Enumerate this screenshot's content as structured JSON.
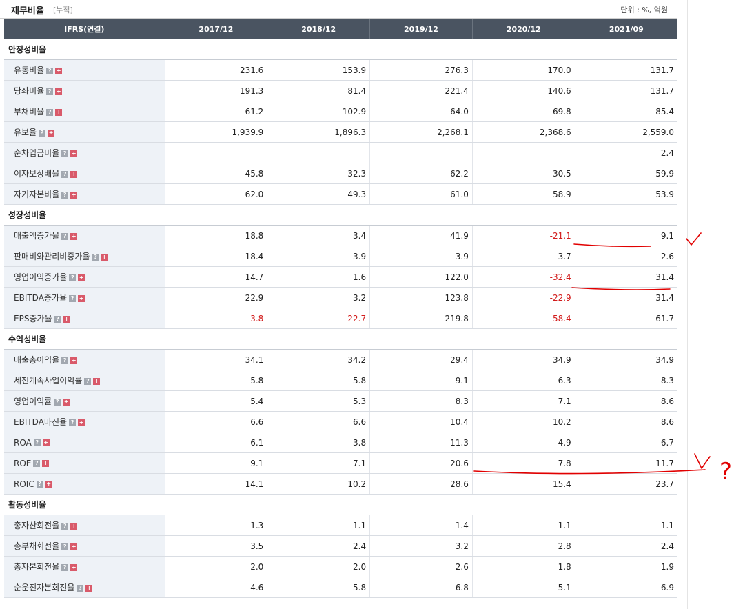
{
  "header": {
    "title": "재무비율",
    "subtitle": "[누적]",
    "unit": "단위 : %, 억원"
  },
  "columns": [
    "IFRS(연결)",
    "2017/12",
    "2018/12",
    "2019/12",
    "2020/12",
    "2021/09"
  ],
  "sections": [
    {
      "name": "안정성비율",
      "rows": [
        {
          "label": "유동비율",
          "values": [
            "231.6",
            "153.9",
            "276.3",
            "170.0",
            "131.7"
          ]
        },
        {
          "label": "당좌비율",
          "values": [
            "191.3",
            "81.4",
            "221.4",
            "140.6",
            "131.7"
          ]
        },
        {
          "label": "부채비율",
          "values": [
            "61.2",
            "102.9",
            "64.0",
            "69.8",
            "85.4"
          ]
        },
        {
          "label": "유보율",
          "values": [
            "1,939.9",
            "1,896.3",
            "2,268.1",
            "2,368.6",
            "2,559.0"
          ]
        },
        {
          "label": "순차입금비율",
          "values": [
            "",
            "",
            "",
            "",
            "2.4"
          ]
        },
        {
          "label": "이자보상배율",
          "values": [
            "45.8",
            "32.3",
            "62.2",
            "30.5",
            "59.9"
          ]
        },
        {
          "label": "자기자본비율",
          "values": [
            "62.0",
            "49.3",
            "61.0",
            "58.9",
            "53.9"
          ]
        }
      ]
    },
    {
      "name": "성장성비율",
      "rows": [
        {
          "label": "매출액증가율",
          "values": [
            "18.8",
            "3.4",
            "41.9",
            "-21.1",
            "9.1"
          ]
        },
        {
          "label": "판매비와관리비증가율",
          "values": [
            "18.4",
            "3.9",
            "3.9",
            "3.7",
            "2.6"
          ]
        },
        {
          "label": "영업이익증가율",
          "values": [
            "14.7",
            "1.6",
            "122.0",
            "-32.4",
            "31.4"
          ]
        },
        {
          "label": "EBITDA증가율",
          "values": [
            "22.9",
            "3.2",
            "123.8",
            "-22.9",
            "31.4"
          ]
        },
        {
          "label": "EPS증가율",
          "values": [
            "-3.8",
            "-22.7",
            "219.8",
            "-58.4",
            "61.7"
          ]
        }
      ]
    },
    {
      "name": "수익성비율",
      "rows": [
        {
          "label": "매출총이익율",
          "values": [
            "34.1",
            "34.2",
            "29.4",
            "34.9",
            "34.9"
          ]
        },
        {
          "label": "세전계속사업이익률",
          "values": [
            "5.8",
            "5.8",
            "9.1",
            "6.3",
            "8.3"
          ]
        },
        {
          "label": "영업이익률",
          "values": [
            "5.4",
            "5.3",
            "8.3",
            "7.1",
            "8.6"
          ]
        },
        {
          "label": "EBITDA마진율",
          "values": [
            "6.6",
            "6.6",
            "10.4",
            "10.2",
            "8.6"
          ]
        },
        {
          "label": "ROA",
          "values": [
            "6.1",
            "3.8",
            "11.3",
            "4.9",
            "6.7"
          ]
        },
        {
          "label": "ROE",
          "values": [
            "9.1",
            "7.1",
            "20.6",
            "7.8",
            "11.7"
          ]
        },
        {
          "label": "ROIC",
          "values": [
            "14.1",
            "10.2",
            "28.6",
            "15.4",
            "23.7"
          ]
        }
      ]
    },
    {
      "name": "활동성비율",
      "rows": [
        {
          "label": "총자산회전율",
          "values": [
            "1.3",
            "1.1",
            "1.4",
            "1.1",
            "1.1"
          ]
        },
        {
          "label": "총부채회전율",
          "values": [
            "3.5",
            "2.4",
            "3.2",
            "2.8",
            "2.4"
          ]
        },
        {
          "label": "총자본회전율",
          "values": [
            "2.0",
            "2.0",
            "2.6",
            "1.8",
            "1.9"
          ]
        },
        {
          "label": "순운전자본회전율",
          "values": [
            "4.6",
            "5.8",
            "6.8",
            "5.1",
            "6.9"
          ]
        }
      ]
    }
  ],
  "icons": {
    "help": "question-icon",
    "expand": "plus-icon"
  },
  "colors": {
    "header_bg": "#4a5461",
    "label_bg": "#eef2f7",
    "negative": "#d21b1b",
    "annotation": "#e10000"
  },
  "annotations": {
    "glyph": "?"
  }
}
